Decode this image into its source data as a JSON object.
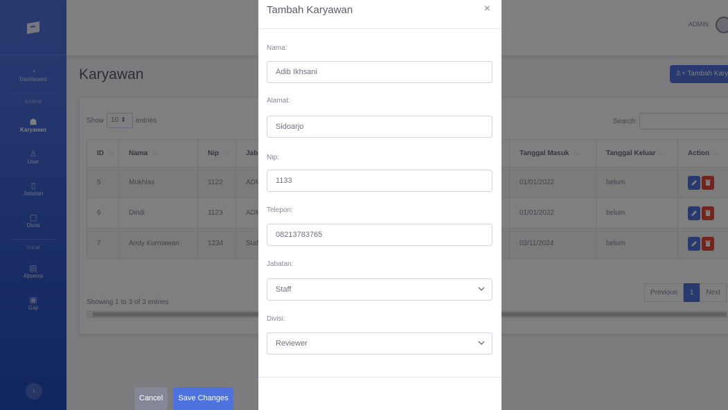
{
  "sidebar": {
    "items": [
      {
        "label": "Dashboard",
        "icon": "gauge-icon"
      },
      {
        "label": "Karyawan",
        "icon": "users-icon"
      },
      {
        "label": "User",
        "icon": "user-icon"
      },
      {
        "label": "Jabatan",
        "icon": "clipboard-icon"
      },
      {
        "label": "Divisi",
        "icon": "monitor-icon"
      },
      {
        "label": "Absensi",
        "icon": "calendar-icon"
      },
      {
        "label": "Gaji",
        "icon": "money-icon"
      }
    ],
    "headings": [
      "ADMIN",
      "VIEW"
    ],
    "toggle_icon": "chevron-right-icon"
  },
  "topbar": {
    "user_name": "ADMIN"
  },
  "page": {
    "title": "Karyawan",
    "add_button": "Tambah Karyawan"
  },
  "table": {
    "show_label": "Show",
    "entries_value": "10",
    "entries_label": "entries",
    "search_label": "Search:",
    "columns": [
      "ID",
      "Nama",
      "Nip",
      "Jabatan",
      "Tanggal Masuk",
      "Tanggal Keluar",
      "Action"
    ],
    "rows": [
      {
        "id": "5",
        "nama": "Mukhlas",
        "nip": "1122",
        "jabatan": "ADMIN",
        "masuk": "01/01/2022",
        "keluar": "belum"
      },
      {
        "id": "6",
        "nama": "Dindi",
        "nip": "1123",
        "jabatan": "ADMIN",
        "masuk": "01/01/2022",
        "keluar": "belum"
      },
      {
        "id": "7",
        "nama": "Andy Kurniawan",
        "nip": "1234",
        "jabatan": "Staff",
        "masuk": "03/11/2024",
        "keluar": "belum"
      }
    ],
    "info": "Showing 1 to 3 of 3 entries",
    "pager": {
      "previous": "Previous",
      "current": "1",
      "next": "Next"
    }
  },
  "modal": {
    "title": "Tambah Karyawan",
    "close": "×",
    "fields": {
      "nama": {
        "label": "Nama:",
        "value": "Adib Ikhsani"
      },
      "alamat": {
        "label": "Alamat:",
        "value": "Sidoarjo"
      },
      "nip": {
        "label": "Nip:",
        "value": "1133"
      },
      "telepon": {
        "label": "Telepon:",
        "value": "08213783765"
      },
      "jabatan": {
        "label": "Jabatan:",
        "value": "Staff"
      },
      "divisi": {
        "label": "Divisi:",
        "value": "Reviewer"
      }
    },
    "cancel": "Cancel",
    "save": "Save Changes"
  },
  "colors": {
    "primary": "#4e73df",
    "danger": "#e74a3b",
    "secondary": "#858796"
  }
}
